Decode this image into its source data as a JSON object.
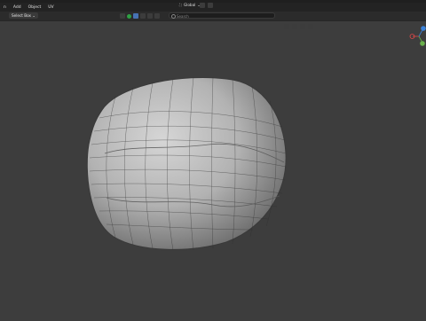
{
  "menu": [
    "n",
    "Add",
    "Object",
    "UV"
  ],
  "header": {
    "mode": "Select Box ⌄",
    "search_placeholder": "Search",
    "transform_space": "Global"
  },
  "icons": {
    "topbar": [
      "filter-icon",
      "visibility-icon",
      "select-icon",
      "move-icon",
      "rotate-icon"
    ],
    "right": [
      "view-icon",
      "filter-icon",
      "funnel-icon"
    ]
  },
  "colors": {
    "bg": "#3d3d3d",
    "accent": "#4772b3",
    "axis_x": "#e04848",
    "axis_y": "#6ab04c",
    "axis_z": "#3b82d9"
  }
}
